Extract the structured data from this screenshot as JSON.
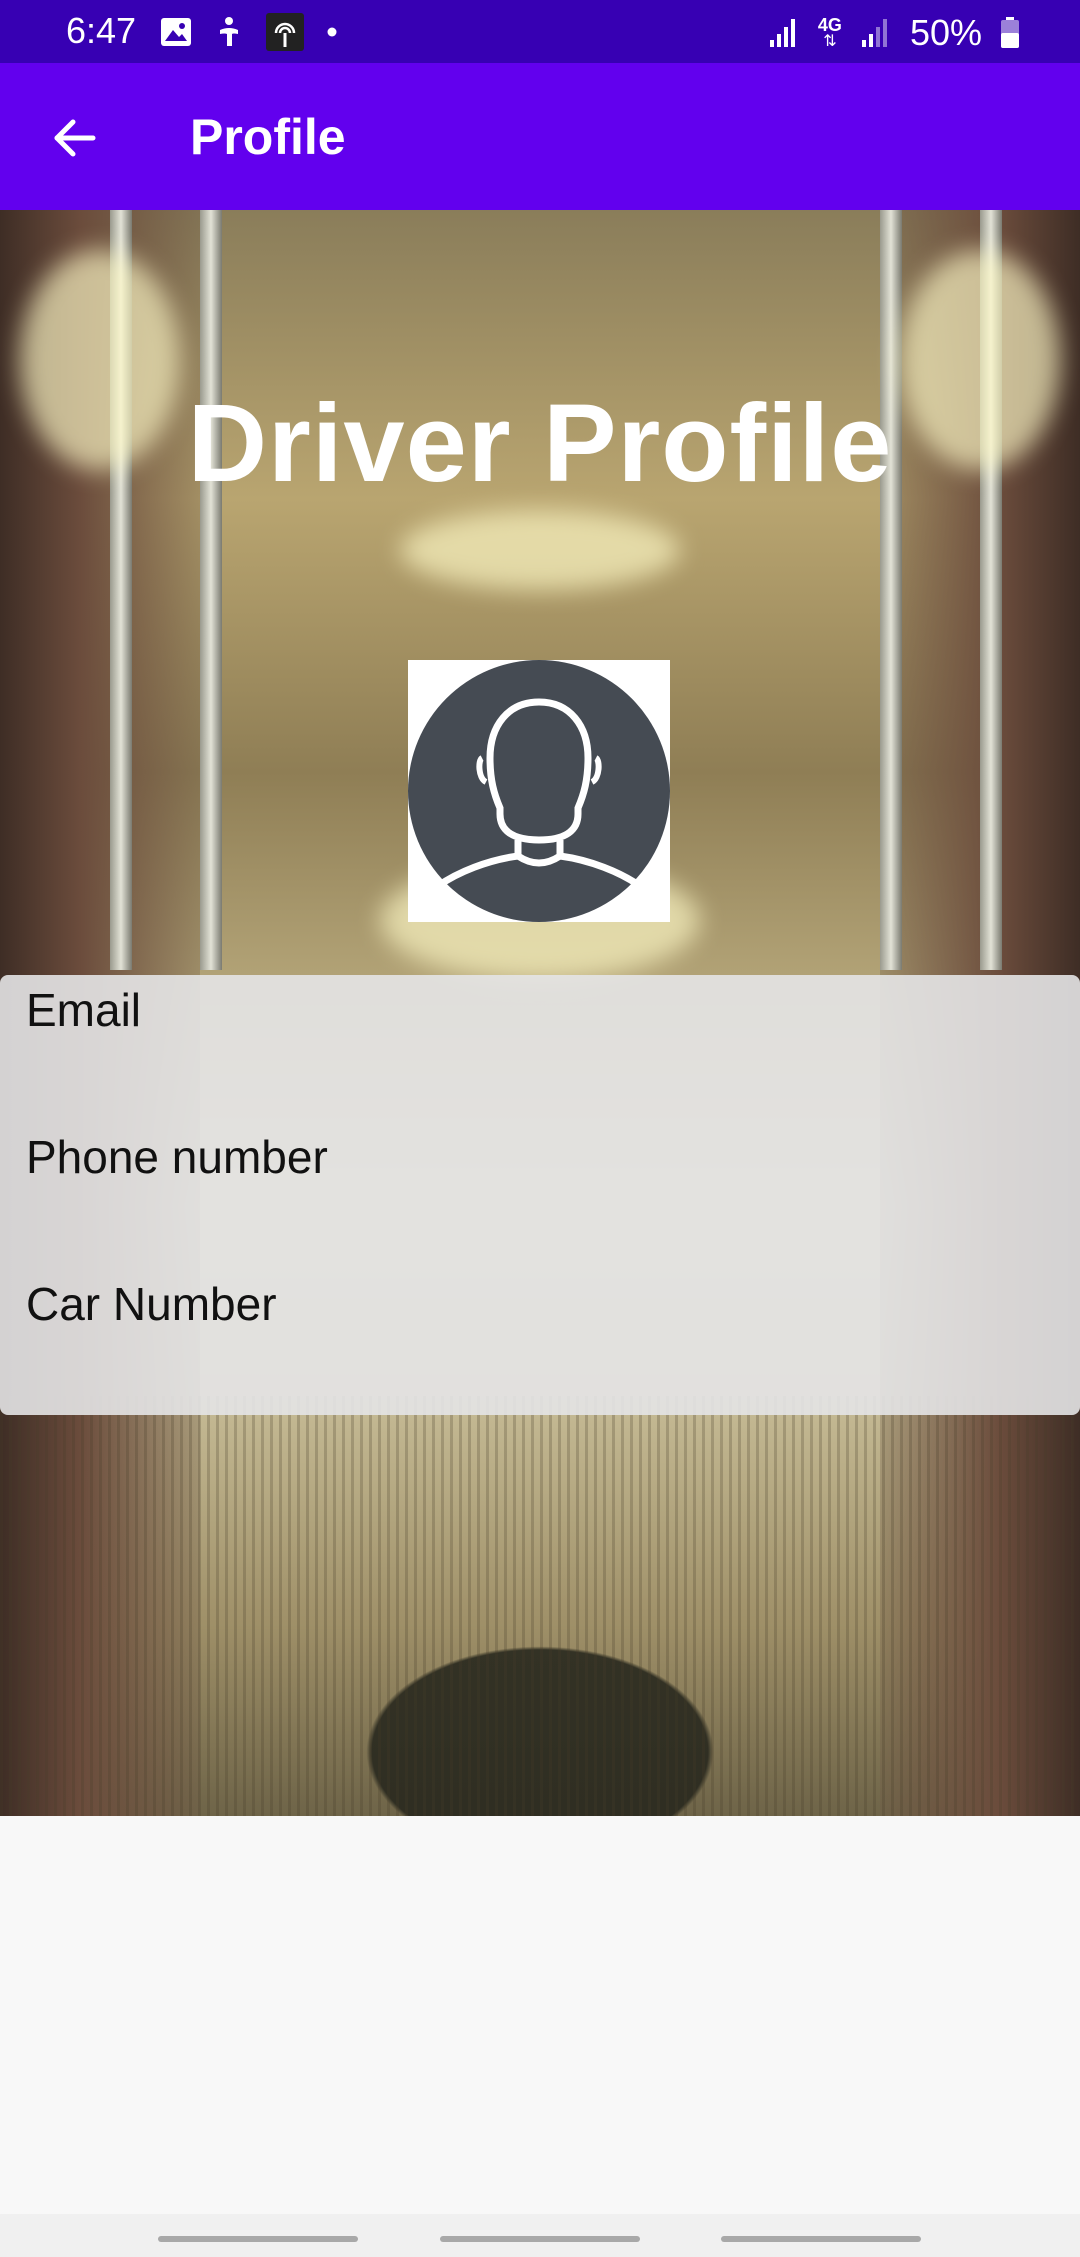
{
  "status_bar": {
    "time": "6:47",
    "network_label": "4G",
    "battery": "50%",
    "left_icons": [
      "image-icon",
      "accessibility-icon",
      "hotspot-icon",
      "dot-icon"
    ],
    "right_icons": [
      "signal-icon",
      "network-4g-icon",
      "signal-weak-icon",
      "battery-icon"
    ]
  },
  "app_bar": {
    "title": "Profile",
    "back_icon": "arrow-back-icon",
    "color": "#6200ee"
  },
  "hero": {
    "title": "Driver Profile",
    "avatar_icon": "user-avatar-icon"
  },
  "fields": [
    {
      "label": "Email",
      "value": ""
    },
    {
      "label": "Phone number",
      "value": ""
    },
    {
      "label": "Car Number",
      "value": ""
    }
  ],
  "colors": {
    "status_bar": "#3700b3",
    "app_bar": "#6200ee",
    "avatar_fill": "#454b53"
  }
}
